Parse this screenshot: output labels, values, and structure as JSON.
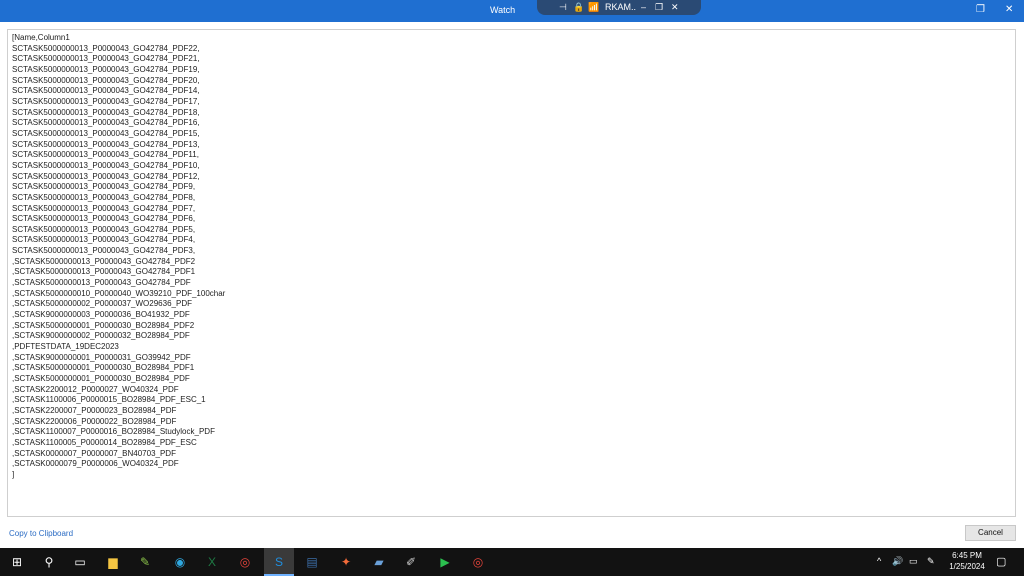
{
  "window": {
    "title": "Watch",
    "rdp": {
      "pin": "⊣",
      "lock": "🔒",
      "signal": "📶",
      "host": "RKAM..",
      "minimize": "–",
      "restore": "❐",
      "close": "✕"
    },
    "controls": {
      "restore": "❐",
      "close": "✕"
    }
  },
  "content": {
    "lines": [
      "[Name,Column1",
      "SCTASK5000000013_P0000043_GO42784_PDF22,",
      "SCTASK5000000013_P0000043_GO42784_PDF21,",
      "SCTASK5000000013_P0000043_GO42784_PDF19,",
      "SCTASK5000000013_P0000043_GO42784_PDF20,",
      "SCTASK5000000013_P0000043_GO42784_PDF14,",
      "SCTASK5000000013_P0000043_GO42784_PDF17,",
      "SCTASK5000000013_P0000043_GO42784_PDF18,",
      "SCTASK5000000013_P0000043_GO42784_PDF16,",
      "SCTASK5000000013_P0000043_GO42784_PDF15,",
      "SCTASK5000000013_P0000043_GO42784_PDF13,",
      "SCTASK5000000013_P0000043_GO42784_PDF11,",
      "SCTASK5000000013_P0000043_GO42784_PDF10,",
      "SCTASK5000000013_P0000043_GO42784_PDF12,",
      "SCTASK5000000013_P0000043_GO42784_PDF9,",
      "SCTASK5000000013_P0000043_GO42784_PDF8,",
      "SCTASK5000000013_P0000043_GO42784_PDF7,",
      "SCTASK5000000013_P0000043_GO42784_PDF6,",
      "SCTASK5000000013_P0000043_GO42784_PDF5,",
      "SCTASK5000000013_P0000043_GO42784_PDF4,",
      "SCTASK5000000013_P0000043_GO42784_PDF3,",
      ",SCTASK5000000013_P0000043_GO42784_PDF2",
      ",SCTASK5000000013_P0000043_GO42784_PDF1",
      ",SCTASK5000000013_P0000043_GO42784_PDF",
      ",SCTASK5000000010_P0000040_WO39210_PDF_100char",
      ",SCTASK5000000002_P0000037_WO29636_PDF",
      ",SCTASK9000000003_P0000036_BO41932_PDF",
      ",SCTASK5000000001_P0000030_BO28984_PDF2",
      ",SCTASK9000000002_P0000032_BO28984_PDF",
      ",PDFTESTDATA_19DEC2023",
      ",SCTASK9000000001_P0000031_GO39942_PDF",
      ",SCTASK5000000001_P0000030_BO28984_PDF1",
      ",SCTASK5000000001_P0000030_BO28984_PDF",
      ",SCTASK2200012_P0000027_WO40324_PDF",
      ",SCTASK1100006_P0000015_BO28984_PDF_ESC_1",
      ",SCTASK2200007_P0000023_BO28984_PDF",
      ",SCTASK2200006_P0000022_BO28984_PDF",
      ",SCTASK1100007_P0000016_BO28984_Studylock_PDF",
      ",SCTASK1100005_P0000014_BO28984_PDF_ESC",
      ",SCTASK0000007_P0000007_BN40703_PDF",
      ",SCTASK0000079_P0000006_WO40324_PDF",
      "]"
    ]
  },
  "footer": {
    "copy_label": "Copy to Clipboard",
    "cancel_label": "Cancel"
  },
  "taskbar": {
    "apps": [
      {
        "name": "start-icon",
        "glyph": "⊞",
        "color": "#ffffff"
      },
      {
        "name": "search-icon",
        "glyph": "⚲",
        "color": "#ffffff"
      },
      {
        "name": "task-view-icon",
        "glyph": "▭",
        "color": "#ffffff"
      },
      {
        "name": "file-explorer-icon",
        "glyph": "▆",
        "color": "#f4c542"
      },
      {
        "name": "notepad-icon",
        "glyph": "✎",
        "color": "#8bc34a"
      },
      {
        "name": "edge-icon",
        "glyph": "◉",
        "color": "#2fa8e0"
      },
      {
        "name": "excel-icon",
        "glyph": "X",
        "color": "#1e7a44"
      },
      {
        "name": "chrome-icon",
        "glyph": "◎",
        "color": "#e8453c"
      },
      {
        "name": "app-s-icon",
        "glyph": "S",
        "color": "#1f8fe0"
      },
      {
        "name": "visual-studio-icon",
        "glyph": "▤",
        "color": "#3c6ea8"
      },
      {
        "name": "postman-icon",
        "glyph": "✦",
        "color": "#f26b3a"
      },
      {
        "name": "notes-icon",
        "glyph": "▰",
        "color": "#6aa0d8"
      },
      {
        "name": "paint-icon",
        "glyph": "✐",
        "color": "#cccccc"
      },
      {
        "name": "media-icon",
        "glyph": "▶",
        "color": "#2bbf4f"
      },
      {
        "name": "chrome-profile-icon",
        "glyph": "◎",
        "color": "#e8453c"
      }
    ],
    "tray": {
      "chevron": "^",
      "volume": "🔊",
      "network": "▭",
      "pen": "✎",
      "notifications": "▢"
    },
    "time": "6:45 PM",
    "date": "1/25/2024"
  }
}
